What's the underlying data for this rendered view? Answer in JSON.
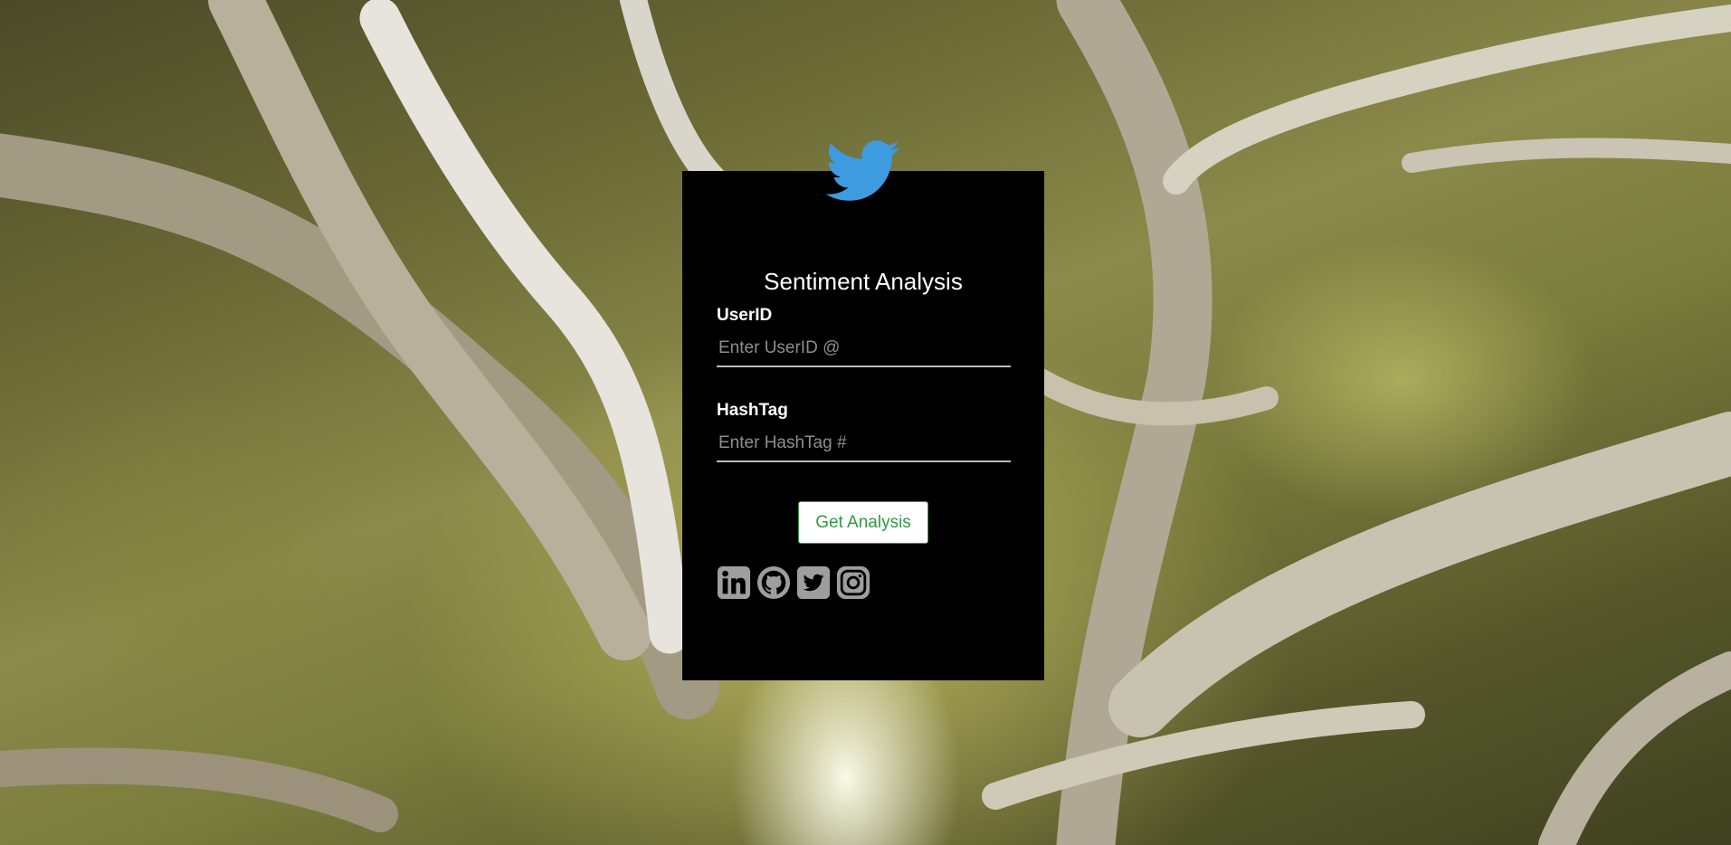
{
  "form": {
    "title": "Sentiment Analysis",
    "userid_label": "UserID",
    "userid_placeholder": "Enter UserID @",
    "hashtag_label": "HashTag",
    "hashtag_placeholder": "Enter HashTag #",
    "submit_label": "Get Analysis"
  },
  "social": [
    "linkedin-icon",
    "github-icon",
    "twitter-icon",
    "instagram-icon"
  ],
  "colors": {
    "card_bg": "#000000",
    "bird": "#3d9be0",
    "button_text": "#2e9a44",
    "social_icon": "#9e9e9e"
  }
}
